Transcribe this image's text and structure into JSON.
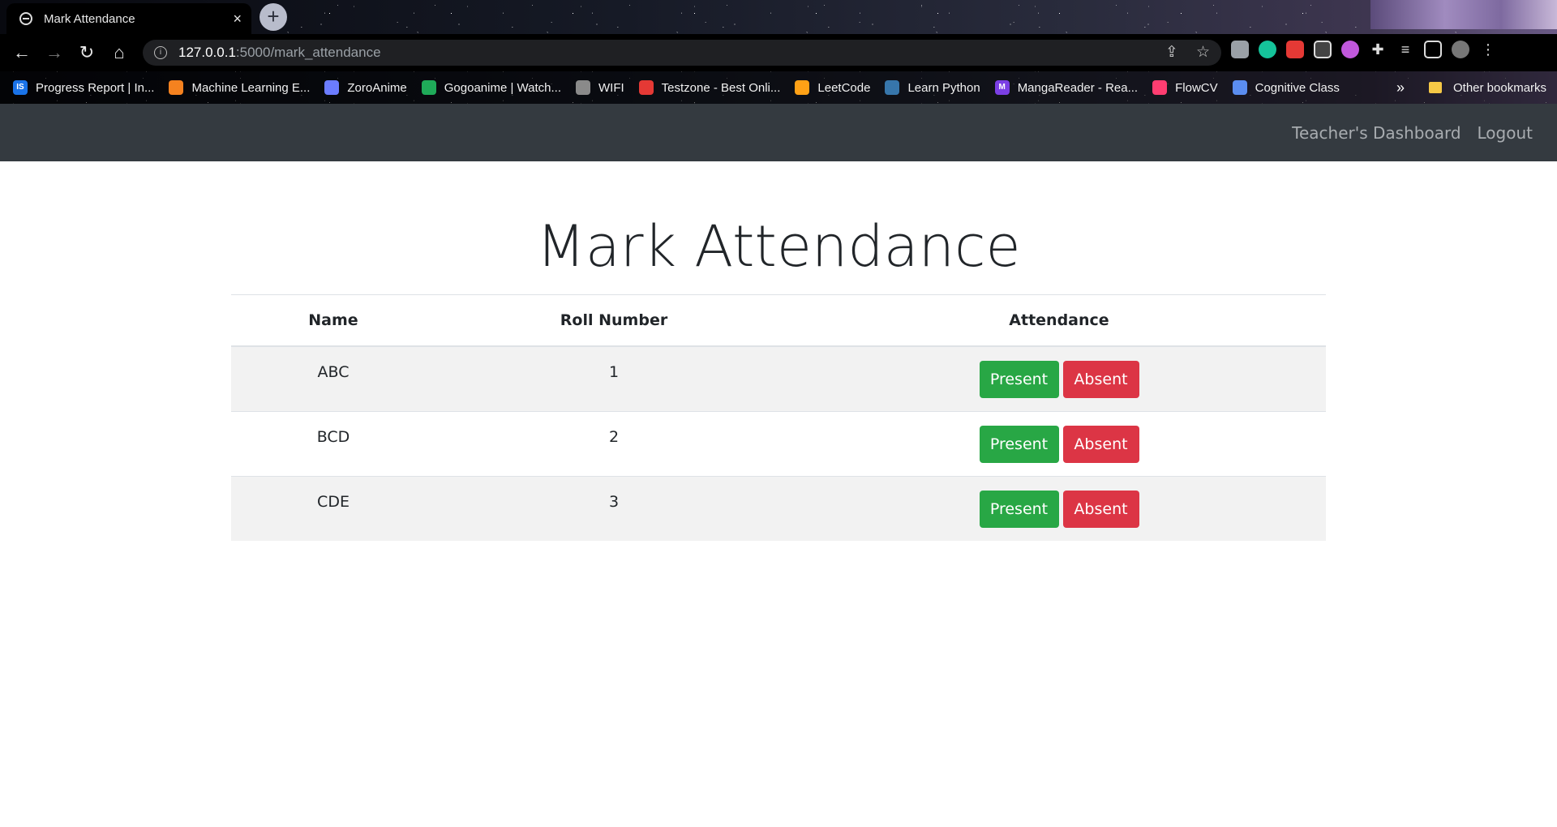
{
  "browser": {
    "tab_title": "Mark Attendance",
    "tab_close": "×",
    "new_tab": "+",
    "url_host": "127.0.0.1",
    "url_path": ":5000/mark_attendance",
    "bookmarks": [
      {
        "label": "Progress Report | In...",
        "color": "#1a73e8",
        "glyph": "IS"
      },
      {
        "label": "Machine Learning E...",
        "color": "#f5821f",
        "glyph": ""
      },
      {
        "label": "ZoroAnime",
        "color": "#6b7cff",
        "glyph": ""
      },
      {
        "label": "Gogoanime | Watch...",
        "color": "#1faa59",
        "glyph": ""
      },
      {
        "label": "WIFI",
        "color": "#8a8a8a",
        "glyph": ""
      },
      {
        "label": "Testzone - Best Onli...",
        "color": "#e53935",
        "glyph": ""
      },
      {
        "label": "LeetCode",
        "color": "#ffa116",
        "glyph": ""
      },
      {
        "label": "Learn Python",
        "color": "#3776ab",
        "glyph": ""
      },
      {
        "label": "MangaReader - Rea...",
        "color": "#7b3fe4",
        "glyph": "M"
      },
      {
        "label": "FlowCV",
        "color": "#ff3d71",
        "glyph": ""
      },
      {
        "label": "Cognitive Class",
        "color": "#5b8def",
        "glyph": ""
      }
    ],
    "bookmarks_more": "»",
    "other_bookmarks": "Other bookmarks"
  },
  "navbar": {
    "links": [
      "Teacher's Dashboard",
      "Logout"
    ]
  },
  "page": {
    "title": "Mark Attendance",
    "columns": [
      "Name",
      "Roll Number",
      "Attendance"
    ],
    "rows": [
      {
        "name": "ABC",
        "roll": "1"
      },
      {
        "name": "BCD",
        "roll": "2"
      },
      {
        "name": "CDE",
        "roll": "3"
      }
    ],
    "present_label": "Present",
    "absent_label": "Absent"
  },
  "colors": {
    "navbar_bg": "#343a40",
    "present": "#28a745",
    "absent": "#dc3545",
    "stripe": "#f2f2f2"
  }
}
